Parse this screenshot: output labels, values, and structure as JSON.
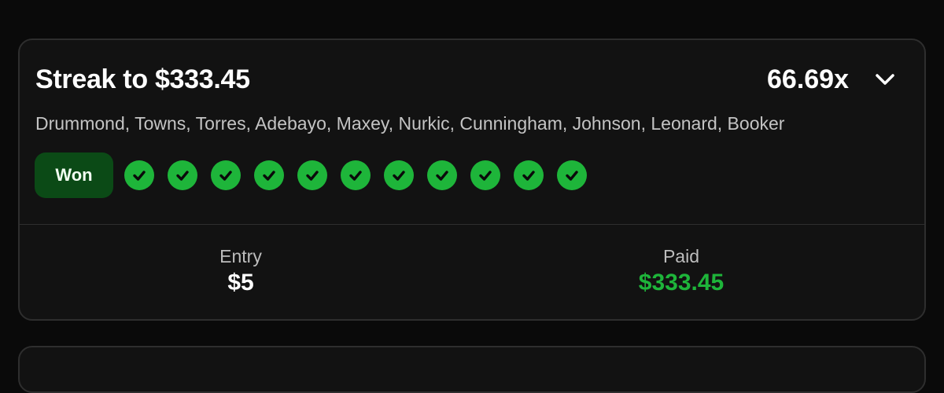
{
  "card": {
    "title": "Streak to $333.45",
    "multiplier": "66.69x",
    "players": "Drummond, Towns, Torres, Adebayo, Maxey, Nurkic, Cunningham, Johnson, Leonard, Booker",
    "status": "Won",
    "picks": [
      {
        "result": "win",
        "icon": "check-circle-icon"
      },
      {
        "result": "win",
        "icon": "check-circle-icon"
      },
      {
        "result": "win",
        "icon": "check-circle-icon"
      },
      {
        "result": "win",
        "icon": "check-circle-icon"
      },
      {
        "result": "win",
        "icon": "check-circle-icon"
      },
      {
        "result": "win",
        "icon": "check-circle-icon"
      },
      {
        "result": "win",
        "icon": "check-circle-icon"
      },
      {
        "result": "win",
        "icon": "check-circle-icon"
      },
      {
        "result": "win",
        "icon": "check-circle-icon"
      },
      {
        "result": "win",
        "icon": "check-circle-icon"
      },
      {
        "result": "win",
        "icon": "check-circle-icon"
      }
    ],
    "entry": {
      "label": "Entry",
      "value": "$5"
    },
    "paid": {
      "label": "Paid",
      "value": "$333.45"
    }
  },
  "colors": {
    "background": "#0a0a0a",
    "card": "#121212",
    "border": "#2e2e2e",
    "accent_green": "#1eb53a",
    "won_badge": "#0b4a16"
  }
}
